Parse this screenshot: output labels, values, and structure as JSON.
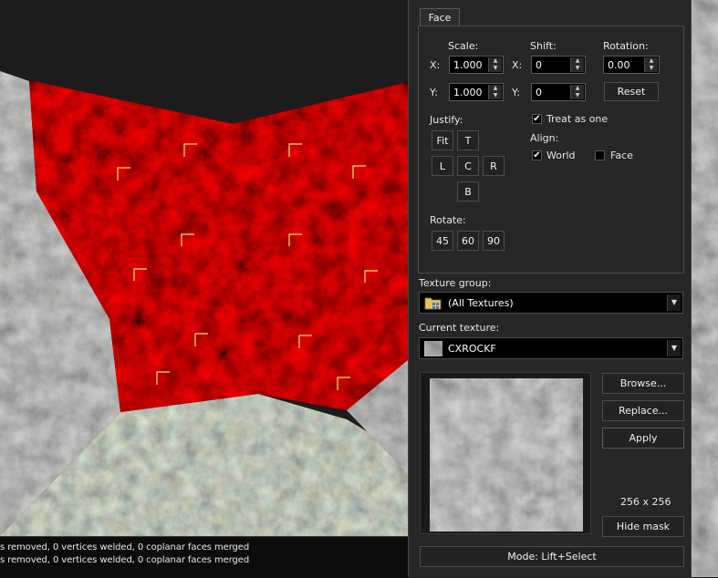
{
  "console": {
    "line1": "s removed, 0 vertices welded, 0 coplanar faces merged",
    "line2": "s removed, 0 vertices welded, 0 coplanar faces merged"
  },
  "panel": {
    "tab_face": "Face",
    "scale_label": "Scale:",
    "shift_label": "Shift:",
    "rotation_label": "Rotation:",
    "x_label": "X:",
    "y_label": "Y:",
    "scale_x": "1.000",
    "scale_y": "1.000",
    "shift_x": "0",
    "shift_y": "0",
    "rotation": "0.00",
    "reset_label": "Reset",
    "justify_label": "Justify:",
    "justify_fit": "Fit",
    "justify_t": "T",
    "justify_l": "L",
    "justify_c": "C",
    "justify_r": "R",
    "justify_b": "B",
    "treat_as_one": "Treat as one",
    "treat_as_one_checked": true,
    "align_label": "Align:",
    "align_world": "World",
    "align_world_checked": true,
    "align_face": "Face",
    "align_face_checked": false,
    "rotate_label": "Rotate:",
    "rotate_45": "45",
    "rotate_60": "60",
    "rotate_90": "90",
    "texture_group_label": "Texture group:",
    "texture_group_value": "(All Textures)",
    "current_texture_label": "Current texture:",
    "current_texture_value": "CXROCKF",
    "browse_label": "Browse...",
    "replace_label": "Replace...",
    "apply_label": "Apply",
    "texture_size": "256 x 256",
    "hide_mask_label": "Hide mask",
    "mode_label": "Mode: Lift+Select"
  },
  "colors": {
    "selected_face": "#b00000",
    "rock": "#7a7670",
    "panel_bg": "#262626"
  }
}
